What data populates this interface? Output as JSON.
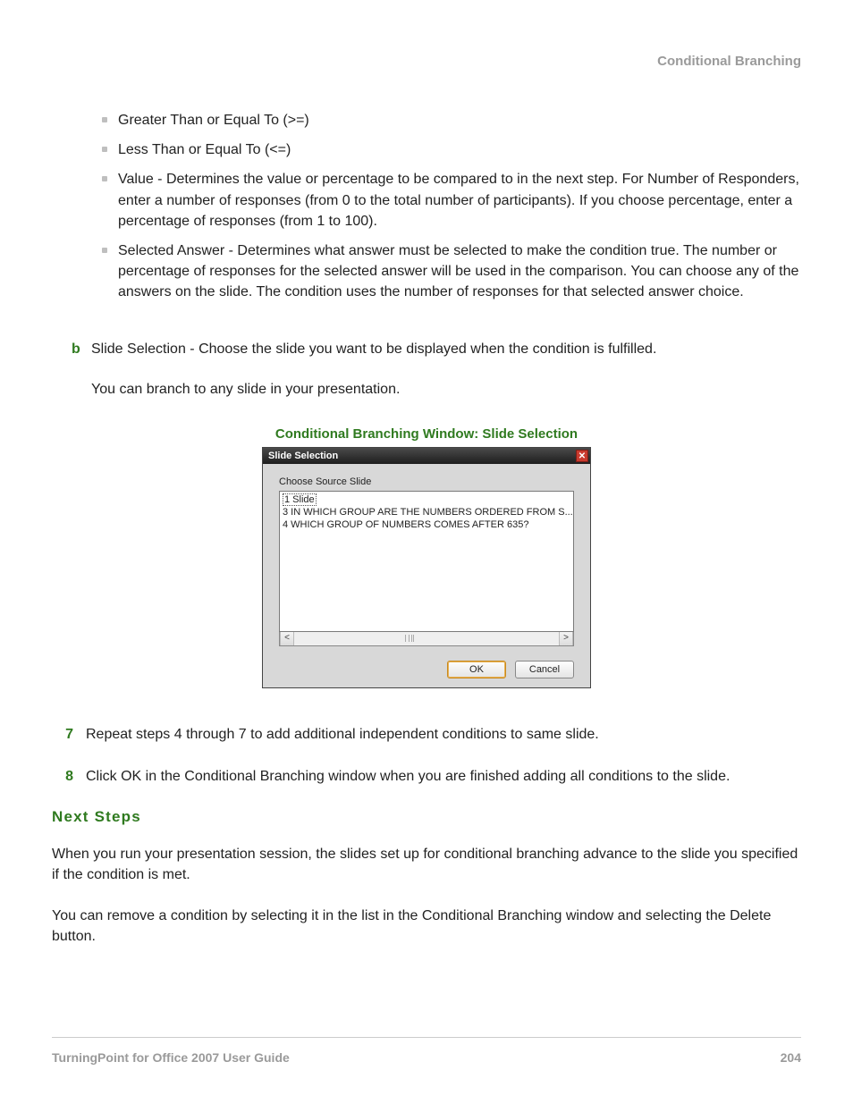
{
  "header": {
    "section": "Conditional Branching"
  },
  "bullets": [
    "Greater Than or Equal To (>=)",
    "Less Than or Equal To (<=)",
    "Value - Determines the value or percentage to be compared to in the next step. For Number of Responders, enter a number of responses (from 0 to the total number of participants). If you choose percentage, enter a percentage of responses (from 1 to 100).",
    "Selected Answer - Determines what answer must be selected to make the condition true. The number or percentage of responses for the selected answer will be used in the comparison. You can choose any of the answers on the slide. The condition uses the number of responses for that selected answer choice."
  ],
  "step_b": {
    "label": "b",
    "text": "Slide Selection - Choose the slide you want to be displayed when the condition is fulfilled.",
    "note": "You can branch to any slide in your presentation."
  },
  "figure": {
    "caption": "Conditional Branching Window: Slide Selection"
  },
  "dialog": {
    "title": "Slide Selection",
    "choose_label": "Choose Source Slide",
    "items": [
      "1 Slide",
      "3 IN WHICH GROUP ARE THE NUMBERS ORDERED FROM S...",
      "4 WHICH GROUP OF NUMBERS COMES AFTER 635?"
    ],
    "ok": "OK",
    "cancel": "Cancel"
  },
  "steps": [
    {
      "num": "7",
      "text": "Repeat steps 4 through 7 to add additional independent conditions to same slide."
    },
    {
      "num": "8",
      "text": "Click OK in the Conditional Branching window when you are finished adding all conditions to the slide."
    }
  ],
  "next_steps": {
    "heading": "Next Steps",
    "p1": "When you run your presentation session, the slides set up for conditional branching advance to the slide you specified if the condition is met.",
    "p2": "You can remove a condition by selecting it in the list in the Conditional Branching window and selecting the Delete button."
  },
  "footer": {
    "left": "TurningPoint for Office 2007 User Guide",
    "right": "204"
  }
}
